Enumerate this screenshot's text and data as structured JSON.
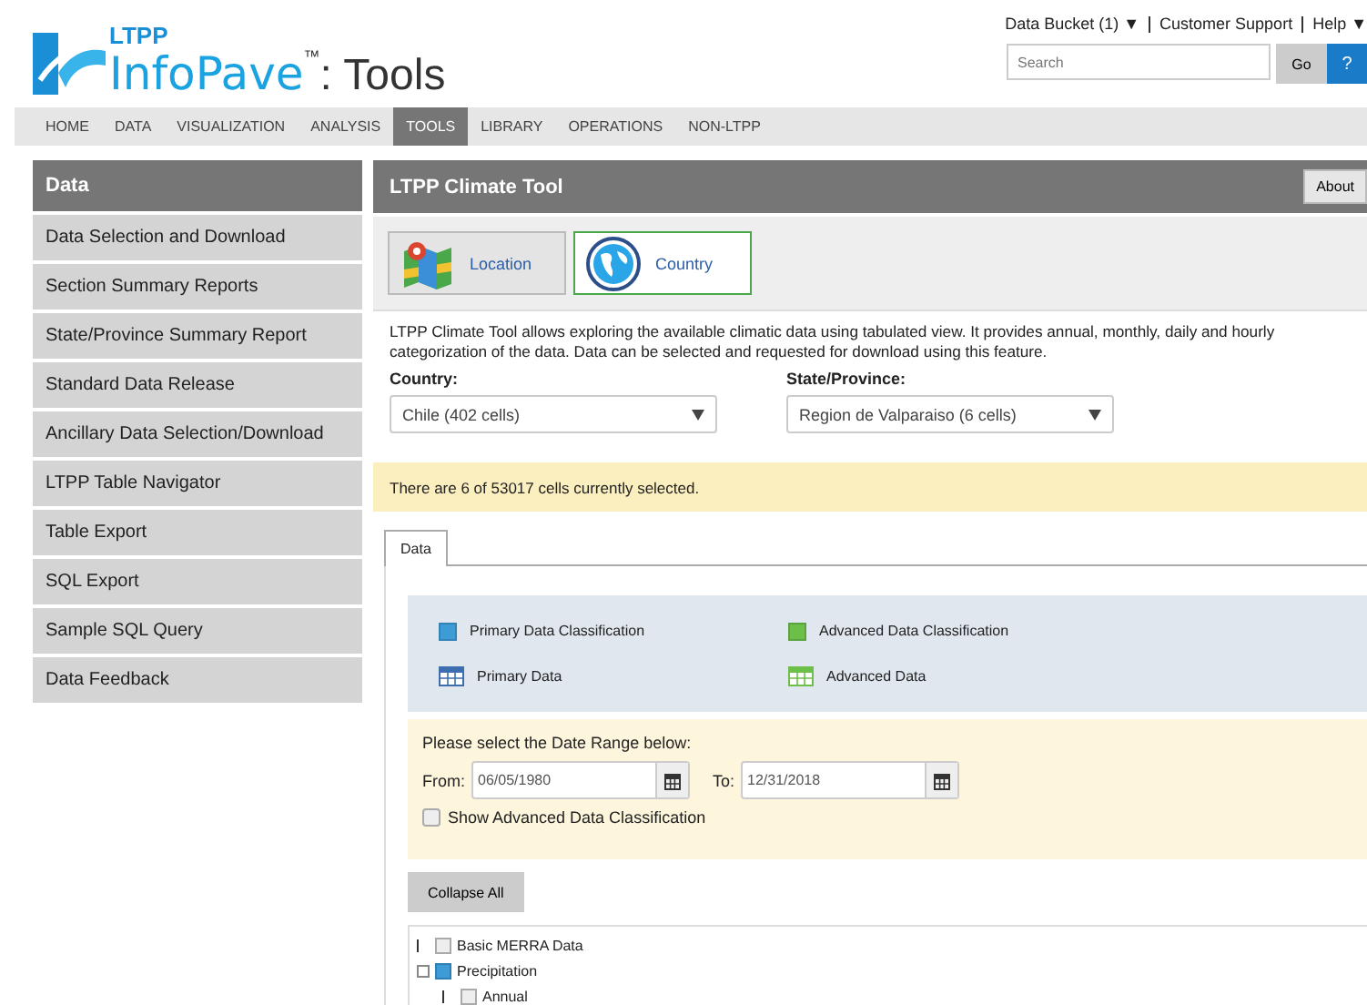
{
  "header": {
    "logo_top": "LTPP",
    "logo_main": "InfoPave",
    "logo_mark": "™",
    "logo_suffix": ": Tools",
    "links": [
      {
        "label": "Data Bucket (1) ▼"
      },
      {
        "label": "Customer Support"
      },
      {
        "label": "Help ▼"
      }
    ],
    "search": {
      "placeholder": "Search"
    },
    "go_button": "Go",
    "help_button": "?"
  },
  "nav": [
    {
      "label": "HOME",
      "selected": false
    },
    {
      "label": "DATA",
      "selected": false
    },
    {
      "label": "VISUALIZATION",
      "selected": false
    },
    {
      "label": "ANALYSIS",
      "selected": false
    },
    {
      "label": "TOOLS",
      "selected": true
    },
    {
      "label": "LIBRARY",
      "selected": false
    },
    {
      "label": "OPERATIONS",
      "selected": false
    },
    {
      "label": "NON-LTPP",
      "selected": false
    }
  ],
  "sidebar": {
    "title": "Data",
    "items": [
      "Data Selection and Download",
      "Section Summary Reports",
      "State/Province Summary Report",
      "Standard Data Release",
      "Ancillary Data Selection/Download",
      "LTPP Table Navigator",
      "Table Export",
      "SQL Export",
      "Sample SQL Query",
      "Data Feedback"
    ]
  },
  "tool": {
    "title": "LTPP Climate Tool",
    "about_button": "About",
    "modes": [
      {
        "label": "Location",
        "kind": "map",
        "selected": false
      },
      {
        "label": "Country",
        "kind": "globe",
        "selected": true
      }
    ],
    "description": "LTPP Climate Tool allows exploring the available climatic data using tabulated view. It provides annual, monthly, daily and hourly categorization of the data. Data can be selected and requested for download using this feature.",
    "country": {
      "label": "Country:",
      "value": "Chile (402 cells)"
    },
    "state": {
      "label": "State/Province:",
      "value": "Region de Valparaiso (6 cells)"
    },
    "notice": "There are 6 of 53017 cells currently selected.",
    "tabs": [
      {
        "label": "Data",
        "selected": true
      }
    ],
    "legend": [
      {
        "label": "Primary Data Classification",
        "kind": "square",
        "color": "#3d9bd6"
      },
      {
        "label": "Advanced Data Classification",
        "kind": "square",
        "color": "#6cc04a"
      },
      {
        "label": "Primary Data",
        "kind": "table",
        "color": "#3d6fb0"
      },
      {
        "label": "Advanced Data",
        "kind": "table",
        "color": "#6cc04a"
      }
    ],
    "date_prompt": "Please select the Date Range below:",
    "from": {
      "label": "From:",
      "value": "06/05/1980"
    },
    "to": {
      "label": "To:",
      "value": "12/31/2018"
    },
    "advanced": {
      "label": "Show Advanced Data Classification",
      "checked": false
    },
    "collapse_button": "Collapse All",
    "tree": [
      {
        "label": "Basic MERRA Data",
        "checked": false,
        "expanded": false
      },
      {
        "label": "Precipitation",
        "checked": true,
        "expanded": true,
        "children": [
          {
            "label": "Annual",
            "checked": false,
            "expanded": false
          }
        ]
      }
    ]
  }
}
